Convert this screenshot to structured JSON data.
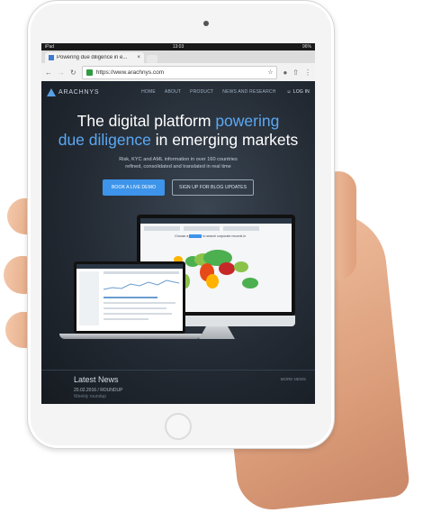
{
  "device": {
    "status_left": "iPad",
    "status_time": "13:03",
    "status_battery": "96%"
  },
  "browser": {
    "tab_title": "Powering due diligence in e...",
    "url": "https://www.arachnys.com"
  },
  "site": {
    "logo_text": "ARACHNYS",
    "nav": [
      "HOME",
      "ABOUT",
      "PRODUCT",
      "NEWS AND RESEARCH"
    ],
    "login_label": "LOG IN",
    "headline_part1": "The digital platform ",
    "headline_accent1": "powering",
    "headline_accent2": "due diligence",
    "headline_part2": " in emerging markets",
    "subtext_line1": "Risk, KYC and AML information in over 160 countries",
    "subtext_line2": "refined, consolidated and translated in real time",
    "cta_primary": "BOOK A LIVE DEMO",
    "cta_secondary": "SIGN UP FOR BLOG UPDATES",
    "monitor_prompt": "Choose a",
    "monitor_prompt2": "to search corporate records in",
    "news_title": "Latest News",
    "news_item_date": "20.02.2016 / ROUNDUP",
    "news_item_more": "Weekly roundup",
    "news_link": "MORE NEWS"
  },
  "colors": {
    "accent": "#5aa9f5",
    "cta": "#3d94ea",
    "site_bg": "#232a33"
  }
}
